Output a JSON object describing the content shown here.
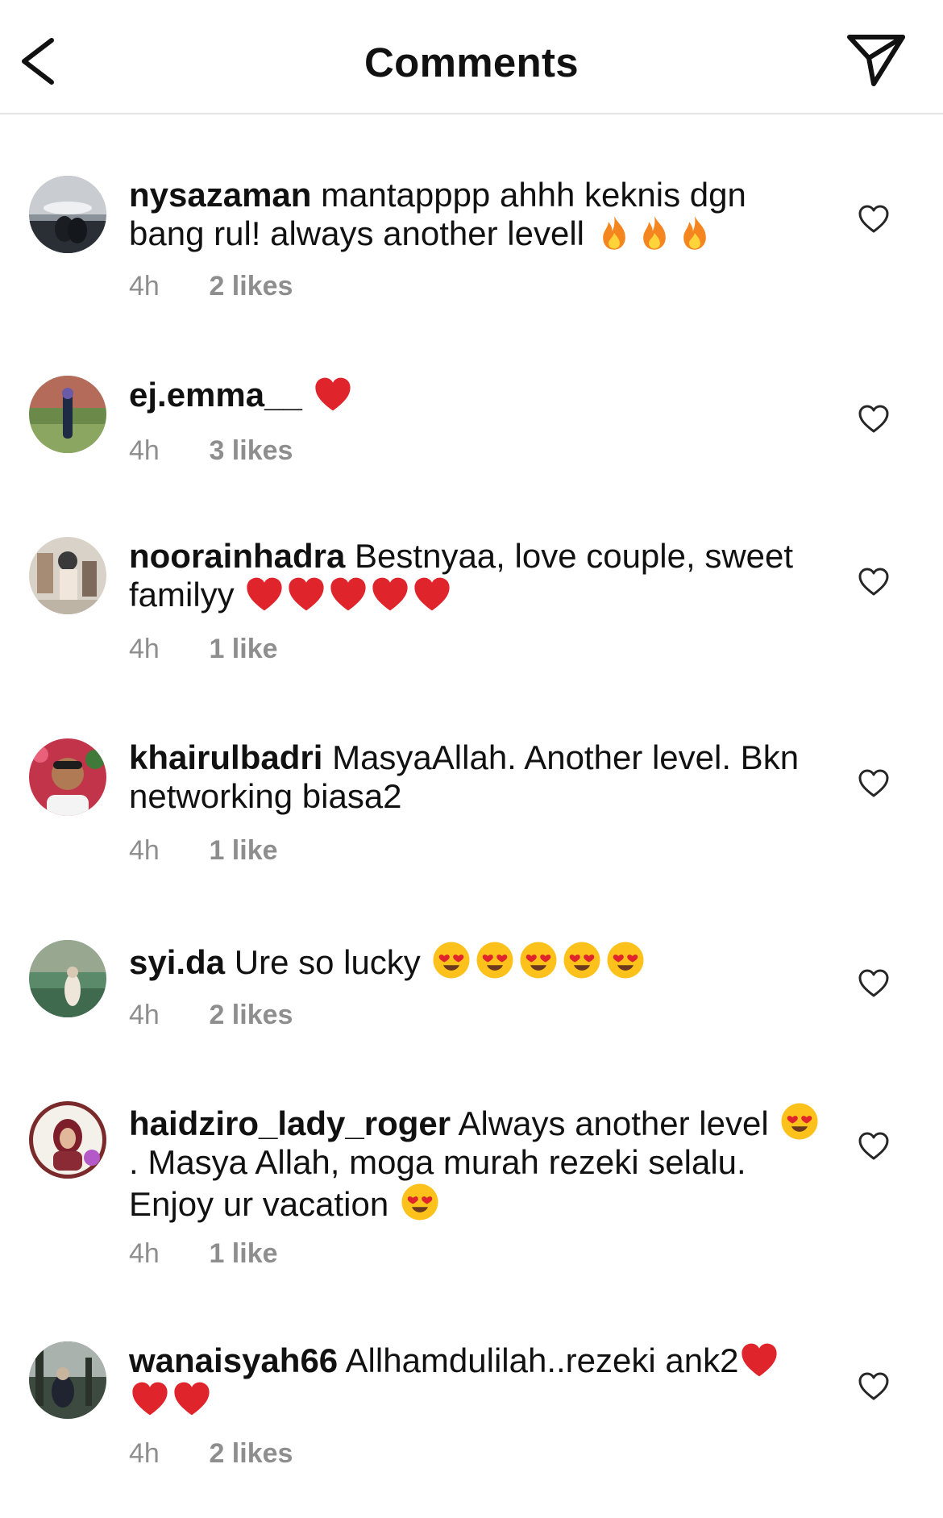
{
  "header": {
    "title": "Comments",
    "back_icon": "chevron-left-icon",
    "share_icon": "paper-plane-icon"
  },
  "comments": [
    {
      "username": "nysazaman",
      "text": "mantapppp ahhh keknis dgn bang rul! always another levell",
      "emojis": [
        "fire",
        "fire",
        "fire"
      ],
      "time": "4h",
      "likes": "2 likes"
    },
    {
      "username": "ej.emma__",
      "text": "",
      "emojis": [
        "red-heart"
      ],
      "time": "4h",
      "likes": "3 likes"
    },
    {
      "username": "noorainhadra",
      "text": "Bestnyaa, love couple, sweet familyy",
      "emojis": [
        "red-heart",
        "red-heart",
        "red-heart",
        "red-heart",
        "red-heart"
      ],
      "time": "4h",
      "likes": "1 like"
    },
    {
      "username": "khairulbadri",
      "text": "MasyaAllah. Another level. Bkn networking biasa2",
      "emojis": [],
      "time": "4h",
      "likes": "1 like"
    },
    {
      "username": "syi.da",
      "text": "Ure so lucky",
      "emojis": [
        "heart-eyes",
        "heart-eyes",
        "heart-eyes",
        "heart-eyes",
        "heart-eyes"
      ],
      "time": "4h",
      "likes": "2 likes"
    },
    {
      "username": "haidziro_lady_roger",
      "text_parts": [
        "Always another level",
        ". Masya Allah, moga murah rezeki selalu. Enjoy ur vacation"
      ],
      "emojis": [
        "heart-eyes",
        "heart-eyes"
      ],
      "time": "4h",
      "likes": "1 like"
    },
    {
      "username": "wanaisyah66",
      "text": "Allhamdulilah..rezeki ank2",
      "emojis": [
        "red-heart",
        "red-heart",
        "red-heart"
      ],
      "time": "4h",
      "likes": "2 likes"
    }
  ],
  "colors": {
    "secondary_text": "#8e8e8e",
    "primary_text": "#111111",
    "divider": "#e6e6e6"
  }
}
